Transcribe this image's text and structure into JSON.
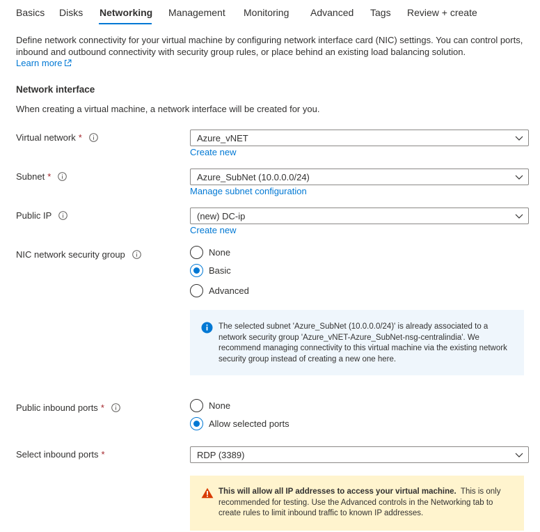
{
  "tabs": [
    {
      "label": "Basics"
    },
    {
      "label": "Disks"
    },
    {
      "label": "Networking"
    },
    {
      "label": "Management"
    },
    {
      "label": "Monitoring"
    },
    {
      "label": "Advanced"
    },
    {
      "label": "Tags"
    },
    {
      "label": "Review + create"
    }
  ],
  "intro": {
    "description": "Define network connectivity for your virtual machine by configuring network interface card (NIC) settings. You can control ports, inbound and outbound connectivity with security group rules, or place behind an existing load balancing solution.",
    "learn_more": "Learn more"
  },
  "network_interface": {
    "title": "Network interface",
    "description": "When creating a virtual machine, a network interface will be created for you."
  },
  "fields": {
    "virtual_network": {
      "label": "Virtual network",
      "required": "*",
      "value": "Azure_vNET",
      "link": "Create new"
    },
    "subnet": {
      "label": "Subnet",
      "required": "*",
      "value": "Azure_SubNet (10.0.0.0/24)",
      "link": "Manage subnet configuration"
    },
    "public_ip": {
      "label": "Public IP",
      "value": "(new) DC-ip",
      "link": "Create new"
    },
    "nsg": {
      "label": "NIC network security group",
      "options": [
        "None",
        "Basic",
        "Advanced"
      ],
      "selected": "Basic",
      "info": "The selected subnet 'Azure_SubNet (10.0.0.0/24)' is already associated to a network security group 'Azure_vNET-Azure_SubNet-nsg-centralindia'. We recommend managing connectivity to this virtual machine via the existing network security group instead of creating a new one here."
    },
    "public_inbound_ports": {
      "label": "Public inbound ports",
      "required": "*",
      "options": [
        "None",
        "Allow selected ports"
      ],
      "selected": "Allow selected ports"
    },
    "select_inbound_ports": {
      "label": "Select inbound ports",
      "required": "*",
      "value": "RDP (3389)"
    }
  },
  "warning": {
    "bold": "This will allow all IP addresses to access your virtual machine.",
    "text": "This is only recommended for testing.  Use the Advanced controls in the Networking tab to create rules to limit inbound traffic to known IP addresses."
  },
  "colors": {
    "accent": "#0078d4",
    "required": "#a4262c",
    "info_bg": "#eff6fc",
    "warning_bg": "#fff4ce",
    "warning_icon": "#d83b01"
  },
  "icons": {
    "info": "info-icon",
    "external_link": "external-link-icon",
    "chevron": "chevron-down-icon",
    "warning": "warning-icon"
  }
}
